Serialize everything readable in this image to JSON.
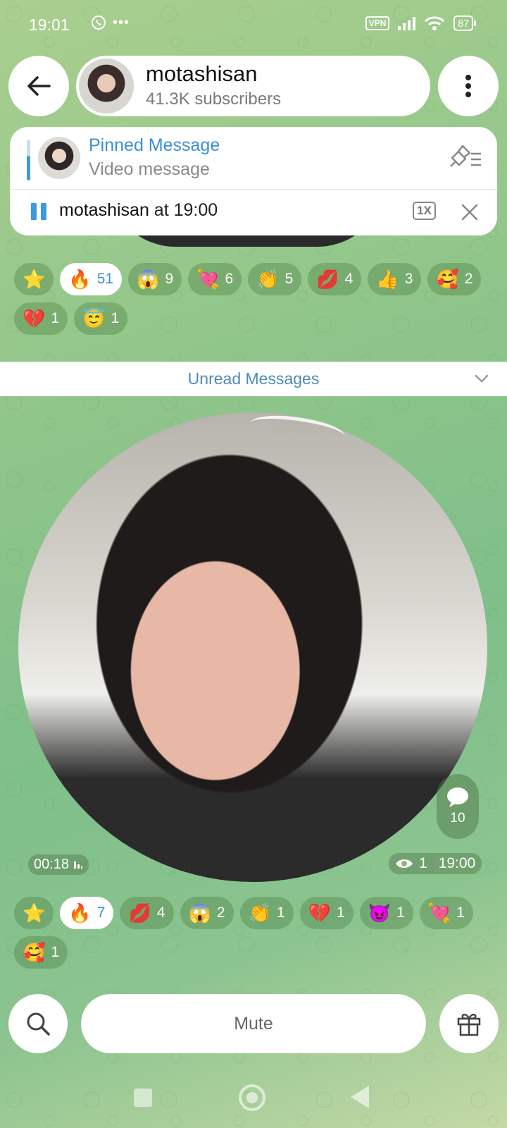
{
  "status": {
    "time": "19:01",
    "vpn": "VPN",
    "battery": "87",
    "icons": [
      "whatsapp-icon",
      "more-dots-icon",
      "signal-icon",
      "wifi-icon"
    ]
  },
  "header": {
    "channel_name": "motashisan",
    "subscribers": "41.3K subscribers"
  },
  "pinned": {
    "title": "Pinned Message",
    "subtitle": "Video message"
  },
  "player": {
    "author": "motashisan",
    "time_text": " at 19:00",
    "speed": "1X"
  },
  "reactions_top": [
    {
      "emoji": "⭐",
      "count": ""
    },
    {
      "emoji": "🔥",
      "count": "51",
      "selected": true
    },
    {
      "emoji": "😱",
      "count": "9"
    },
    {
      "emoji": "💘",
      "count": "6"
    },
    {
      "emoji": "👏",
      "count": "5"
    },
    {
      "emoji": "💋",
      "count": "4"
    },
    {
      "emoji": "👍",
      "count": "3"
    },
    {
      "emoji": "🥰",
      "count": "2"
    },
    {
      "emoji": "💔",
      "count": "1"
    },
    {
      "emoji": "😇",
      "count": "1"
    }
  ],
  "unread_label": "Unread Messages",
  "video": {
    "duration": "00:18",
    "views": "1",
    "time": "19:00",
    "comments": "10"
  },
  "reactions_bottom": [
    {
      "emoji": "⭐",
      "count": ""
    },
    {
      "emoji": "🔥",
      "count": "7",
      "selected": true
    },
    {
      "emoji": "💋",
      "count": "4"
    },
    {
      "emoji": "😱",
      "count": "2"
    },
    {
      "emoji": "👏",
      "count": "1"
    },
    {
      "emoji": "💔",
      "count": "1"
    },
    {
      "emoji": "😈",
      "count": "1"
    },
    {
      "emoji": "💘",
      "count": "1"
    },
    {
      "emoji": "🥰",
      "count": "1"
    }
  ],
  "bottom": {
    "mute_label": "Mute"
  },
  "colors": {
    "accent": "#3b8fd4",
    "unread_text": "#4e8bb8"
  }
}
